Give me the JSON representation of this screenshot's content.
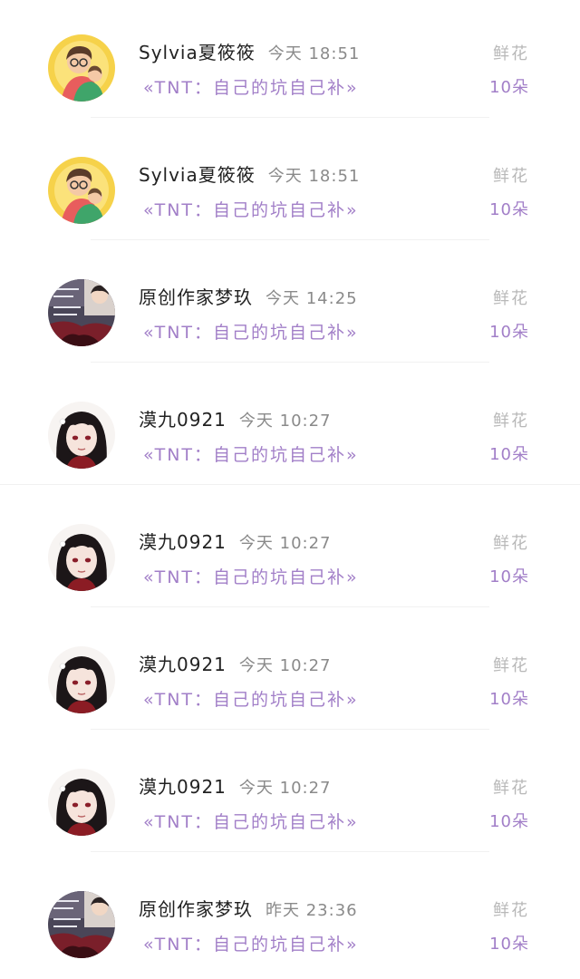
{
  "records": [
    {
      "name": "Sylvia夏筱筱",
      "time": "今天 18:51",
      "book": "«TNT：自己的坑自己补»",
      "gift_type": "鲜花",
      "gift_count": "10朵",
      "avatar": "cartoon-couple"
    },
    {
      "name": "Sylvia夏筱筱",
      "time": "今天 18:51",
      "book": "«TNT：自己的坑自己补»",
      "gift_type": "鲜花",
      "gift_count": "10朵",
      "avatar": "cartoon-couple"
    },
    {
      "name": "原创作家梦玖",
      "time": "今天 14:25",
      "book": "«TNT：自己的坑自己补»",
      "gift_type": "鲜花",
      "gift_count": "10朵",
      "avatar": "photo-collage"
    },
    {
      "name": "漠九0921",
      "time": "今天 10:27",
      "book": "«TNT：自己的坑自己补»",
      "gift_type": "鲜花",
      "gift_count": "10朵",
      "avatar": "anime-character"
    },
    {
      "name": "漠九0921",
      "time": "今天 10:27",
      "book": "«TNT：自己的坑自己补»",
      "gift_type": "鲜花",
      "gift_count": "10朵",
      "avatar": "anime-character"
    },
    {
      "name": "漠九0921",
      "time": "今天 10:27",
      "book": "«TNT：自己的坑自己补»",
      "gift_type": "鲜花",
      "gift_count": "10朵",
      "avatar": "anime-character"
    },
    {
      "name": "漠九0921",
      "time": "今天 10:27",
      "book": "«TNT：自己的坑自己补»",
      "gift_type": "鲜花",
      "gift_count": "10朵",
      "avatar": "anime-character"
    },
    {
      "name": "原创作家梦玖",
      "time": "昨天 23:36",
      "book": "«TNT：自己的坑自己补»",
      "gift_type": "鲜花",
      "gift_count": "10朵",
      "avatar": "photo-collage"
    }
  ],
  "colors": {
    "accent": "#a27fc8",
    "muted": "#b8b8b8",
    "name": "#222222",
    "time": "#8a8a8a"
  }
}
